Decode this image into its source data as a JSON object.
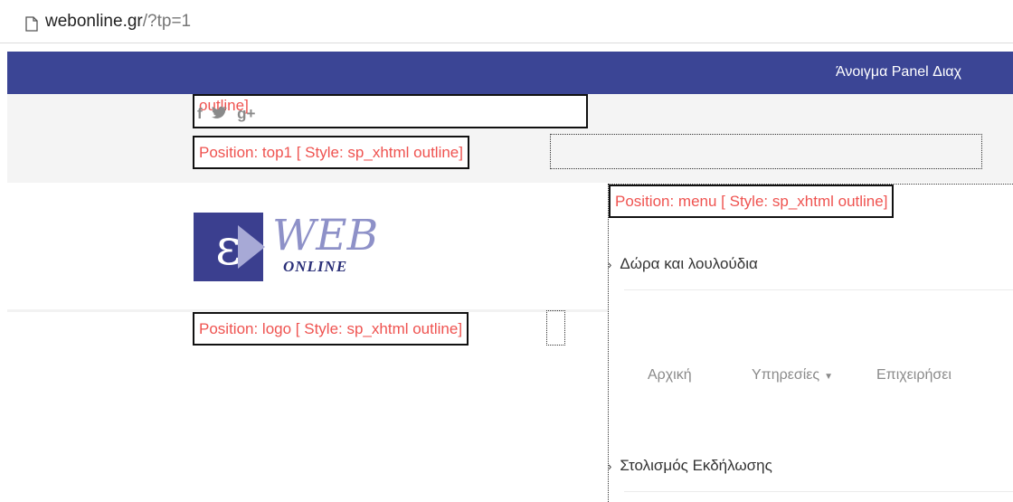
{
  "browser": {
    "url_host": "webonline.gr",
    "url_rest": "/?tp=1",
    "page_icon": "page-icon"
  },
  "topbar": {
    "panel_link": "Άνοιγμα Panel Διαχ",
    "background": "#3b4595"
  },
  "modules": {
    "social_label": "outline]",
    "top1_label": "Position: top1 [ Style: sp_xhtml outline]",
    "menu_label": "Position: menu [ Style: sp_xhtml outline]",
    "logo_label": "Position: logo [ Style: sp_xhtml outline]",
    "label_color": "#ef5350"
  },
  "social": {
    "facebook": "f",
    "twitter": "🐦",
    "googleplus": "g+"
  },
  "logo": {
    "mark": "ε",
    "web": "WEB",
    "online": "ONLINE",
    "brand_color": "#3b3f8f"
  },
  "menu": {
    "items": [
      "Δώρα και λουλούδια",
      "Στολισμός Εκδήλωσης"
    ],
    "caret": "›"
  },
  "main_nav": {
    "items": [
      "Αρχική",
      "Υπηρεσίες",
      "Επιχειρήσει"
    ],
    "dropdown_icon": "chevron-down-icon"
  }
}
